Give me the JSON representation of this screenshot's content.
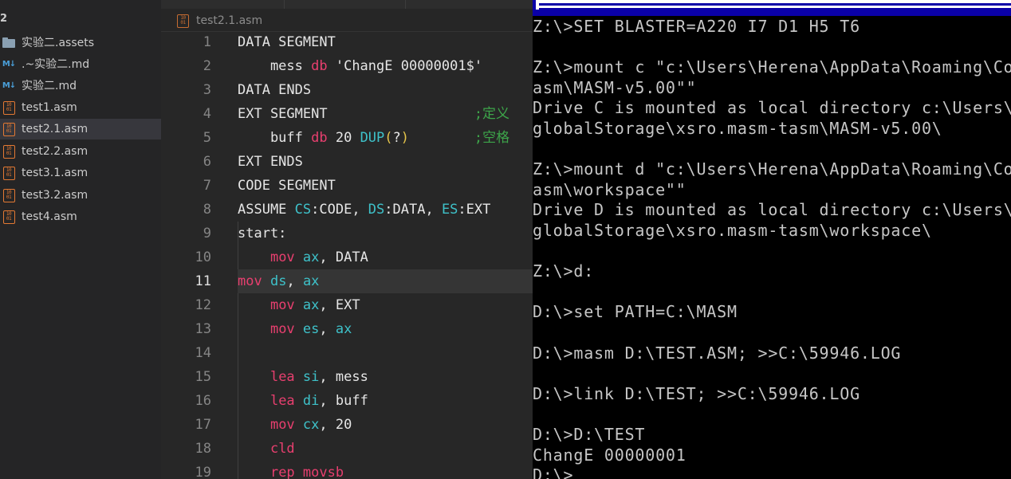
{
  "sidebar": {
    "header": "2",
    "items": [
      {
        "label": "实验二.assets",
        "icon": "folder-icon"
      },
      {
        "label": ".~实验二.md",
        "icon": "markdown-icon",
        "icon_text": "M↓"
      },
      {
        "label": "实验二.md",
        "icon": "markdown-icon",
        "icon_text": "M↓"
      },
      {
        "label": "test1.asm",
        "icon": "asm-file-icon",
        "icon_text": "10\n01"
      },
      {
        "label": "test2.1.asm",
        "icon": "asm-file-icon",
        "icon_text": "10\n01",
        "active": true
      },
      {
        "label": "test2.2.asm",
        "icon": "asm-file-icon",
        "icon_text": "10\n01"
      },
      {
        "label": "test3.1.asm",
        "icon": "asm-file-icon",
        "icon_text": "10\n01"
      },
      {
        "label": "test3.2.asm",
        "icon": "asm-file-icon",
        "icon_text": "10\n01"
      },
      {
        "label": "test4.asm",
        "icon": "asm-file-icon",
        "icon_text": "10\n01"
      }
    ]
  },
  "editor": {
    "tab": {
      "label": "test2.1.asm",
      "icon": "asm-file-icon",
      "icon_text": "10\n01"
    },
    "current_line": "11",
    "lines": [
      {
        "n": "1",
        "tokens": [
          [
            "DATA SEGMENT",
            "plain"
          ]
        ]
      },
      {
        "n": "2",
        "tokens": [
          [
            "    mess ",
            "plain"
          ],
          [
            "db",
            "pink"
          ],
          [
            " 'ChangE 00000001$'",
            "plain"
          ]
        ]
      },
      {
        "n": "3",
        "tokens": [
          [
            "DATA ENDS",
            "plain"
          ]
        ]
      },
      {
        "n": "4",
        "tokens": [
          [
            "EXT SEGMENT",
            "plain"
          ],
          [
            "                  ;定义",
            "cmt"
          ]
        ]
      },
      {
        "n": "5",
        "tokens": [
          [
            "    buff ",
            "plain"
          ],
          [
            "db",
            "pink"
          ],
          [
            " 20 ",
            "plain"
          ],
          [
            "DUP",
            "teal"
          ],
          [
            "(",
            "yel"
          ],
          [
            "?",
            "plain"
          ],
          [
            ")",
            "yel"
          ],
          [
            "        ;空格",
            "cmt"
          ]
        ]
      },
      {
        "n": "6",
        "tokens": [
          [
            "EXT ENDS",
            "plain"
          ]
        ]
      },
      {
        "n": "7",
        "tokens": [
          [
            "CODE SEGMENT",
            "plain"
          ]
        ]
      },
      {
        "n": "8",
        "tokens": [
          [
            "ASSUME ",
            "plain"
          ],
          [
            "CS",
            "teal"
          ],
          [
            ":CODE, ",
            "plain"
          ],
          [
            "DS",
            "teal"
          ],
          [
            ":DATA, ",
            "plain"
          ],
          [
            "ES",
            "teal"
          ],
          [
            ":EXT",
            "plain"
          ]
        ]
      },
      {
        "n": "9",
        "tokens": [
          [
            "start:",
            "plain"
          ]
        ]
      },
      {
        "n": "10",
        "tokens": [
          [
            "    ",
            "plain"
          ],
          [
            "mov",
            "pink"
          ],
          [
            " ",
            "plain"
          ],
          [
            "ax",
            "teal"
          ],
          [
            ", DATA",
            "plain"
          ]
        ]
      },
      {
        "n": "11",
        "tokens": [
          [
            "mov",
            "pink"
          ],
          [
            " ",
            "plain"
          ],
          [
            "ds",
            "teal"
          ],
          [
            ", ",
            "plain"
          ],
          [
            "ax",
            "teal"
          ]
        ]
      },
      {
        "n": "12",
        "tokens": [
          [
            "    ",
            "plain"
          ],
          [
            "mov",
            "pink"
          ],
          [
            " ",
            "plain"
          ],
          [
            "ax",
            "teal"
          ],
          [
            ", EXT",
            "plain"
          ]
        ]
      },
      {
        "n": "13",
        "tokens": [
          [
            "    ",
            "plain"
          ],
          [
            "mov",
            "pink"
          ],
          [
            " ",
            "plain"
          ],
          [
            "es",
            "teal"
          ],
          [
            ", ",
            "plain"
          ],
          [
            "ax",
            "teal"
          ]
        ]
      },
      {
        "n": "14",
        "tokens": [
          [
            "",
            "plain"
          ]
        ]
      },
      {
        "n": "15",
        "tokens": [
          [
            "    ",
            "plain"
          ],
          [
            "lea",
            "pink"
          ],
          [
            " ",
            "plain"
          ],
          [
            "si",
            "teal"
          ],
          [
            ", mess",
            "plain"
          ]
        ]
      },
      {
        "n": "16",
        "tokens": [
          [
            "    ",
            "plain"
          ],
          [
            "lea",
            "pink"
          ],
          [
            " ",
            "plain"
          ],
          [
            "di",
            "teal"
          ],
          [
            ", buff",
            "plain"
          ]
        ]
      },
      {
        "n": "17",
        "tokens": [
          [
            "    ",
            "plain"
          ],
          [
            "mov",
            "pink"
          ],
          [
            " ",
            "plain"
          ],
          [
            "cx",
            "teal"
          ],
          [
            ", 20",
            "plain"
          ]
        ]
      },
      {
        "n": "18",
        "tokens": [
          [
            "    ",
            "plain"
          ],
          [
            "cld",
            "pink"
          ]
        ]
      },
      {
        "n": "19",
        "tokens": [
          [
            "    ",
            "plain"
          ],
          [
            "rep movsb",
            "pink"
          ]
        ]
      }
    ]
  },
  "dosbox": {
    "lines": [
      "Z:\\>SET BLASTER=A220 I7 D1 H5 T6",
      "",
      "Z:\\>mount c \"c:\\Users\\Herena\\AppData\\Roaming\\Co",
      "asm\\MASM-v5.00\"\"",
      "Drive C is mounted as local directory c:\\Users\\",
      "globalStorage\\xsro.masm-tasm\\MASM-v5.00\\",
      "",
      "Z:\\>mount d \"c:\\Users\\Herena\\AppData\\Roaming\\Co",
      "asm\\workspace\"\"",
      "Drive D is mounted as local directory c:\\Users\\",
      "globalStorage\\xsro.masm-tasm\\workspace\\",
      "",
      "Z:\\>d:",
      "",
      "D:\\>set PATH=C:\\MASM",
      "",
      "D:\\>masm D:\\TEST.ASM; >>C:\\59946.LOG",
      "",
      "D:\\>link D:\\TEST; >>C:\\59946.LOG",
      "",
      "D:\\>D:\\TEST",
      "ChangE 00000001",
      "D:\\>_"
    ]
  },
  "colors": {
    "sidebar_bg": "#252526",
    "editor_bg": "#272727",
    "keyword_pink": "#e83f6f",
    "register_teal": "#3ec1c9",
    "comment_green": "#3da54a",
    "paren_yellow": "#e5c54a",
    "dos_text": "#c6c6c6",
    "dos_titlebar": "#0a00a8"
  }
}
